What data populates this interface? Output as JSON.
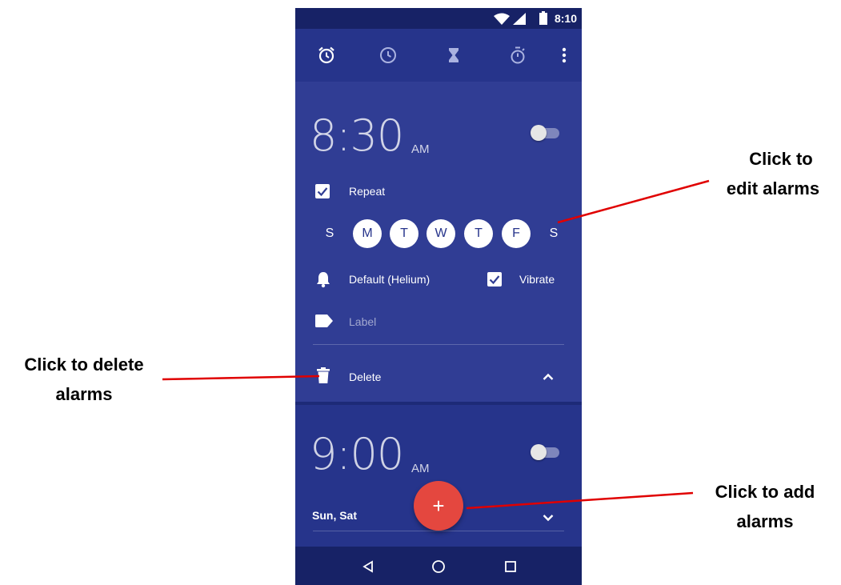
{
  "status_bar": {
    "time": "8:10",
    "icons": [
      "wifi-icon",
      "signal-icon",
      "battery-icon"
    ]
  },
  "toolbar": {
    "icons": [
      "alarm-icon",
      "clock-icon",
      "timer-icon",
      "stopwatch-icon",
      "more-vert-icon"
    ]
  },
  "alarm1": {
    "time": "8:30",
    "ampm": "AM",
    "enabled": false,
    "repeat_label": "Repeat",
    "repeat_checked": true,
    "days": [
      {
        "label": "S",
        "selected": false
      },
      {
        "label": "M",
        "selected": true
      },
      {
        "label": "T",
        "selected": true
      },
      {
        "label": "W",
        "selected": true
      },
      {
        "label": "T",
        "selected": true
      },
      {
        "label": "F",
        "selected": true
      },
      {
        "label": "S",
        "selected": false
      }
    ],
    "ringtone": "Default (Helium)",
    "vibrate_label": "Vibrate",
    "vibrate_checked": true,
    "label_placeholder": "Label",
    "delete_label": "Delete"
  },
  "alarm2": {
    "time": "9:00",
    "ampm": "AM",
    "enabled": false,
    "days_summary": "Sun, Sat"
  },
  "annotations": {
    "edit_line1": "Click to",
    "edit_line2": "edit alarms",
    "delete_line1": "Click to delete",
    "delete_line2": "alarms",
    "add_line1": "Click to add",
    "add_line2": "alarms"
  },
  "colors": {
    "toolbar": "#26348b",
    "expanded_card": "#303d94",
    "fab": "#e4473f",
    "annotation_line": "#e00000"
  }
}
